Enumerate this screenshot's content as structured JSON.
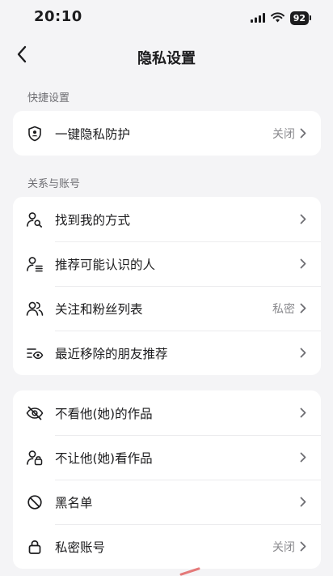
{
  "status": {
    "time": "20:10",
    "battery": "92"
  },
  "nav": {
    "title": "隐私设置"
  },
  "sections": {
    "quick": {
      "label": "快捷设置",
      "rows": [
        {
          "label": "一键隐私防护",
          "value": "关闭",
          "icon": "shield-person-icon"
        }
      ]
    },
    "relations": {
      "label": "关系与账号",
      "rows": [
        {
          "label": "找到我的方式",
          "value": "",
          "icon": "person-search-icon"
        },
        {
          "label": "推荐可能认识的人",
          "value": "",
          "icon": "person-list-icon"
        },
        {
          "label": "关注和粉丝列表",
          "value": "私密",
          "icon": "people-icon"
        },
        {
          "label": "最近移除的朋友推荐",
          "value": "",
          "icon": "list-eye-icon"
        }
      ]
    },
    "visibility": {
      "rows": [
        {
          "label": "不看他(她)的作品",
          "value": "",
          "icon": "eye-off-icon"
        },
        {
          "label": "不让他(她)看作品",
          "value": "",
          "icon": "person-lock-icon"
        },
        {
          "label": "黑名单",
          "value": "",
          "icon": "block-icon"
        },
        {
          "label": "私密账号",
          "value": "关闭",
          "icon": "lock-icon"
        }
      ]
    }
  }
}
